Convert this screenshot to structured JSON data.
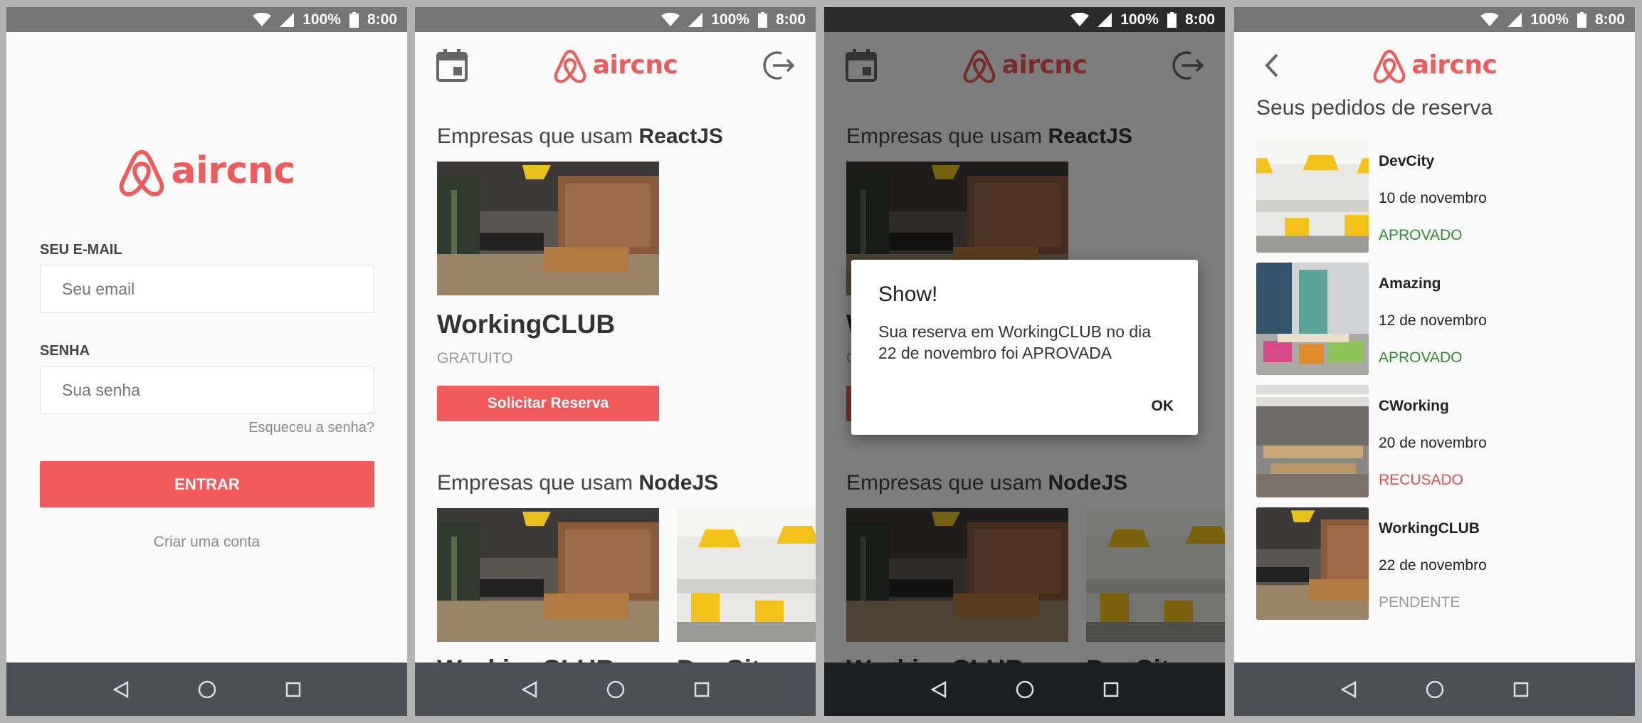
{
  "status": {
    "battery": "100%",
    "time": "8:00"
  },
  "brand": {
    "name": "aircnc",
    "color": "#f05a5b"
  },
  "login": {
    "email_label": "SEU E-MAIL",
    "email_placeholder": "Seu email",
    "password_label": "SENHA",
    "password_placeholder": "Sua senha",
    "forgot": "Esqueceu a senha?",
    "submit": "ENTRAR",
    "create_account": "Criar uma conta"
  },
  "list": {
    "section1_prefix": "Empresas que usam ",
    "section1_tech": "ReactJS",
    "spot_name": "WorkingCLUB",
    "spot_price": "GRATUITO",
    "request_button": "Solicitar Reserva",
    "section2_prefix": "Empresas que usam ",
    "section2_tech": "NodeJS",
    "cut_name_1": "WorkingCLUB",
    "cut_name_2": "DevCity"
  },
  "dialog": {
    "title": "Show!",
    "message": "Sua reserva em WorkingCLUB no dia 22 de novembro foi APROVADA",
    "ok": "OK"
  },
  "bookings": {
    "title": "Seus pedidos de reserva",
    "items": [
      {
        "name": "DevCity",
        "date": "10 de novembro",
        "status": "APROVADO",
        "status_color": "#2e8b2e"
      },
      {
        "name": "Amazing",
        "date": "12 de novembro",
        "status": "APROVADO",
        "status_color": "#2e8b2e"
      },
      {
        "name": "CWorking",
        "date": "20 de novembro",
        "status": "RECUSADO",
        "status_color": "#e8484b"
      },
      {
        "name": "WorkingCLUB",
        "date": "22 de novembro",
        "status": "PENDENTE",
        "status_color": "#999999"
      }
    ]
  }
}
